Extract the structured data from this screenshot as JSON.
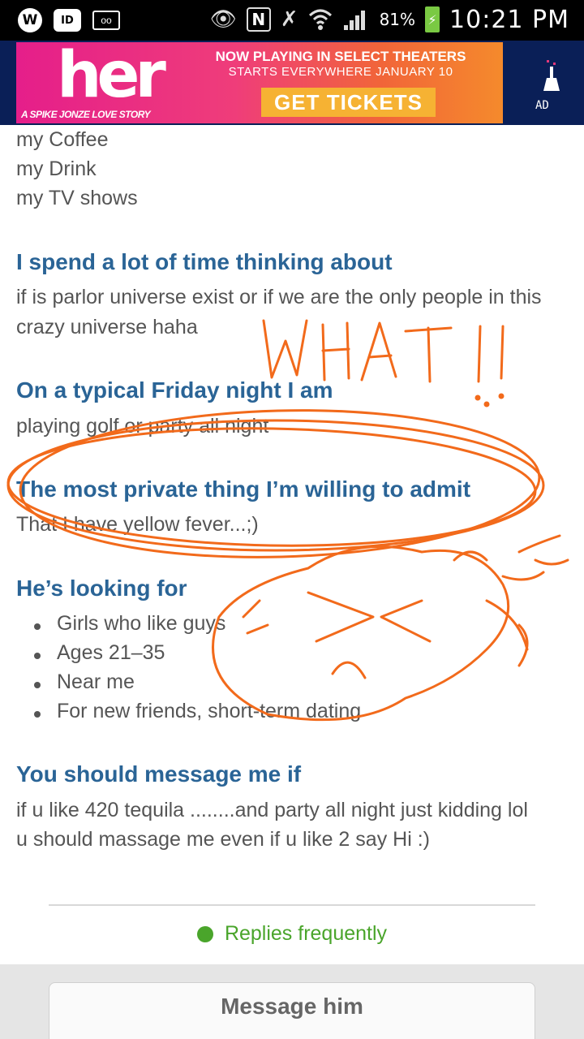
{
  "statusbar": {
    "battery": "81%",
    "time": "10:21 PM",
    "left_icons": [
      "w-badge-icon",
      "id-badge-icon",
      "voicemail-icon"
    ],
    "right_icons": [
      "eye-icon",
      "nfc-icon",
      "mute-icon",
      "wifi-icon",
      "signal-icon",
      "battery-icon"
    ]
  },
  "ad": {
    "logo": "her",
    "tagline": "A SPIKE JONZE LOVE STORY",
    "line1": "NOW PLAYING IN SELECT THEATERS",
    "line2": "STARTS EVERYWHERE JANUARY 10",
    "cta": "GET TICKETS",
    "label": "AD"
  },
  "profile": {
    "favorites_tail": [
      "my Coffee",
      "my Drink",
      "my TV shows"
    ],
    "sections": [
      {
        "heading": "I spend a lot of time thinking about",
        "lines": [
          "if is parlor universe exist or if we are the only people in this",
          "crazy universe haha"
        ]
      },
      {
        "heading": "On a typical Friday night I am",
        "lines": [
          "playing golf or party all night"
        ]
      },
      {
        "heading": "The most private thing I’m willing to admit",
        "lines": [
          "That I have yellow fever...;)"
        ]
      },
      {
        "heading": "He’s looking for",
        "bullets": [
          "Girls who like guys",
          "Ages 21–35",
          "Near me",
          "For new friends, short-term dating"
        ]
      },
      {
        "heading": "You should message me if",
        "lines": [
          "if u like 420 tequila ........and party all night just kidding lol",
          "u should massage me even if u like 2 say Hi :)"
        ]
      }
    ]
  },
  "annotation": {
    "text": "WHAT!!",
    "color": "#f26a1b"
  },
  "status": {
    "text": "Replies frequently"
  },
  "footer": {
    "message_button": "Message him"
  }
}
